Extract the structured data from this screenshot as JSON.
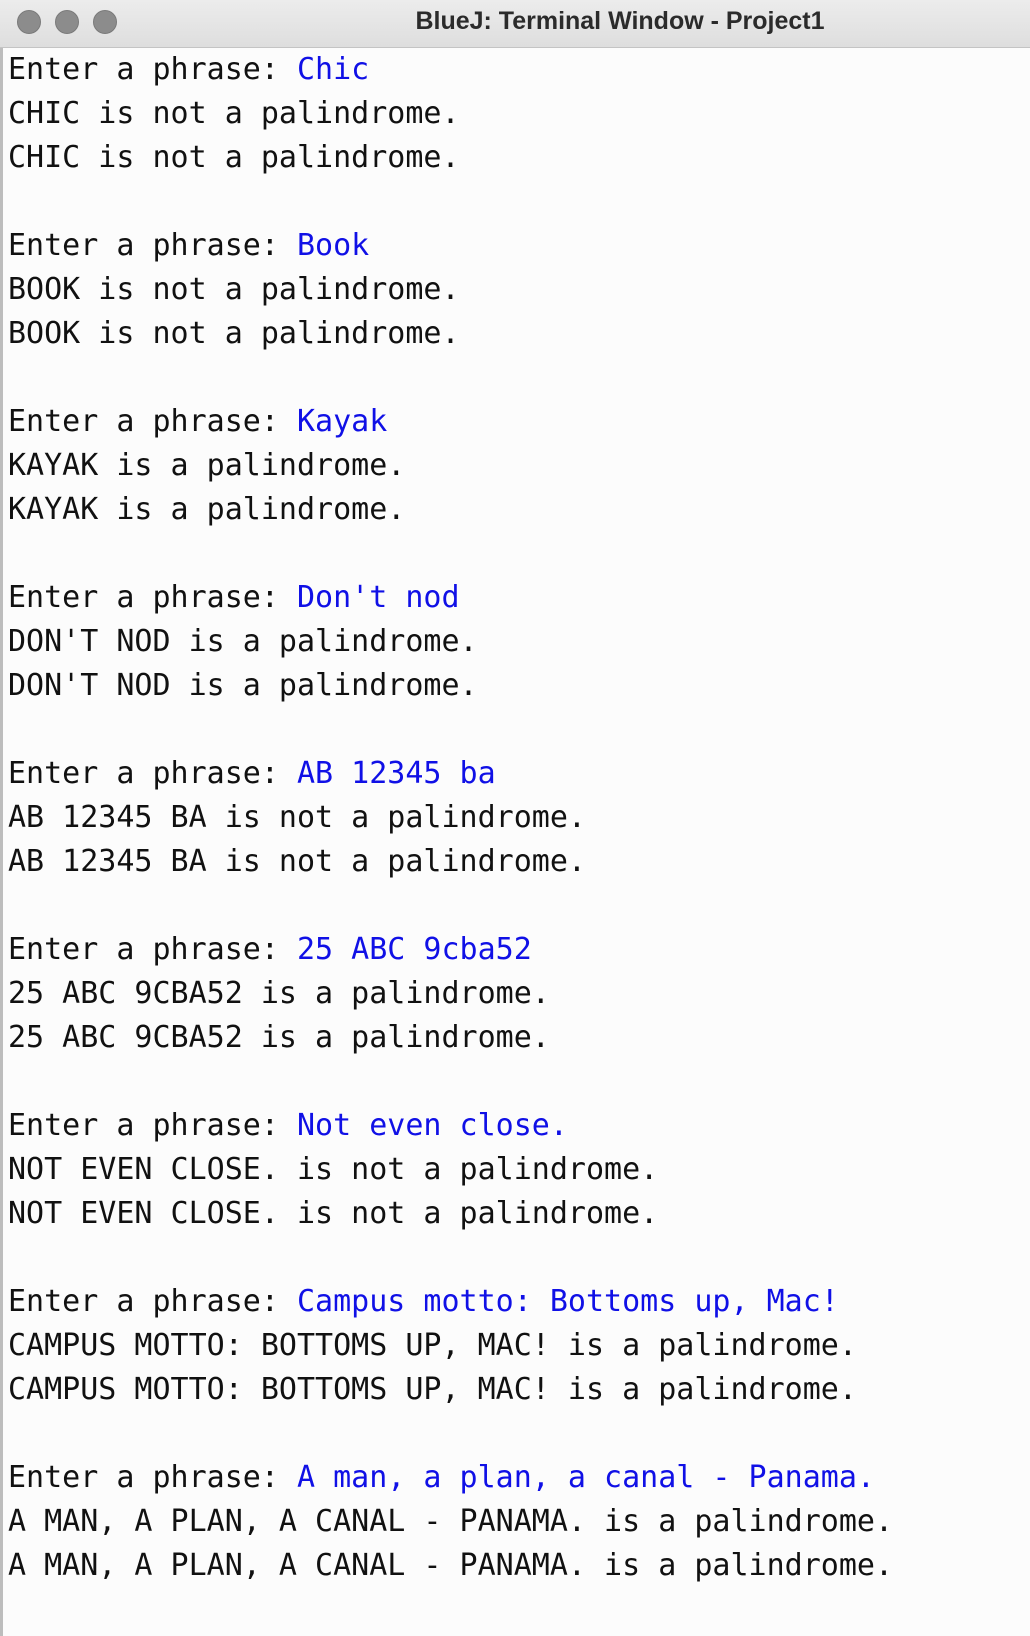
{
  "window": {
    "title": "BlueJ: Terminal Window - Project1",
    "buttons": [
      "close-icon",
      "minimize-icon",
      "zoom-icon"
    ]
  },
  "colors": {
    "input_text": "#1010e6",
    "output_text": "#111111",
    "background": "#fcfcfc"
  },
  "terminal": {
    "prompt": "Enter a phrase: ",
    "entries": [
      {
        "input": "Chic",
        "outputs": [
          "CHIC is not a palindrome.",
          "CHIC is not a palindrome."
        ]
      },
      {
        "input": "Book",
        "outputs": [
          "BOOK is not a palindrome.",
          "BOOK is not a palindrome."
        ]
      },
      {
        "input": "Kayak",
        "outputs": [
          "KAYAK is a palindrome.",
          "KAYAK is a palindrome."
        ]
      },
      {
        "input": "Don't nod",
        "outputs": [
          "DON'T NOD is a palindrome.",
          "DON'T NOD is a palindrome."
        ]
      },
      {
        "input": "AB 12345 ba",
        "outputs": [
          "AB 12345 BA is not a palindrome.",
          "AB 12345 BA is not a palindrome."
        ]
      },
      {
        "input": "25 ABC 9cba52",
        "outputs": [
          "25 ABC 9CBA52 is a palindrome.",
          "25 ABC 9CBA52 is a palindrome."
        ]
      },
      {
        "input": "Not even close.",
        "outputs": [
          "NOT EVEN CLOSE. is not a palindrome.",
          "NOT EVEN CLOSE. is not a palindrome."
        ]
      },
      {
        "input": "Campus motto: Bottoms up, Mac!",
        "outputs": [
          "CAMPUS MOTTO: BOTTOMS UP, MAC! is a palindrome.",
          "CAMPUS MOTTO: BOTTOMS UP, MAC! is a palindrome."
        ]
      },
      {
        "input": "A man, a plan, a canal - Panama.",
        "outputs": [
          "A MAN, A PLAN, A CANAL - PANAMA. is a palindrome.",
          "A MAN, A PLAN, A CANAL - PANAMA. is a palindrome."
        ]
      }
    ]
  }
}
